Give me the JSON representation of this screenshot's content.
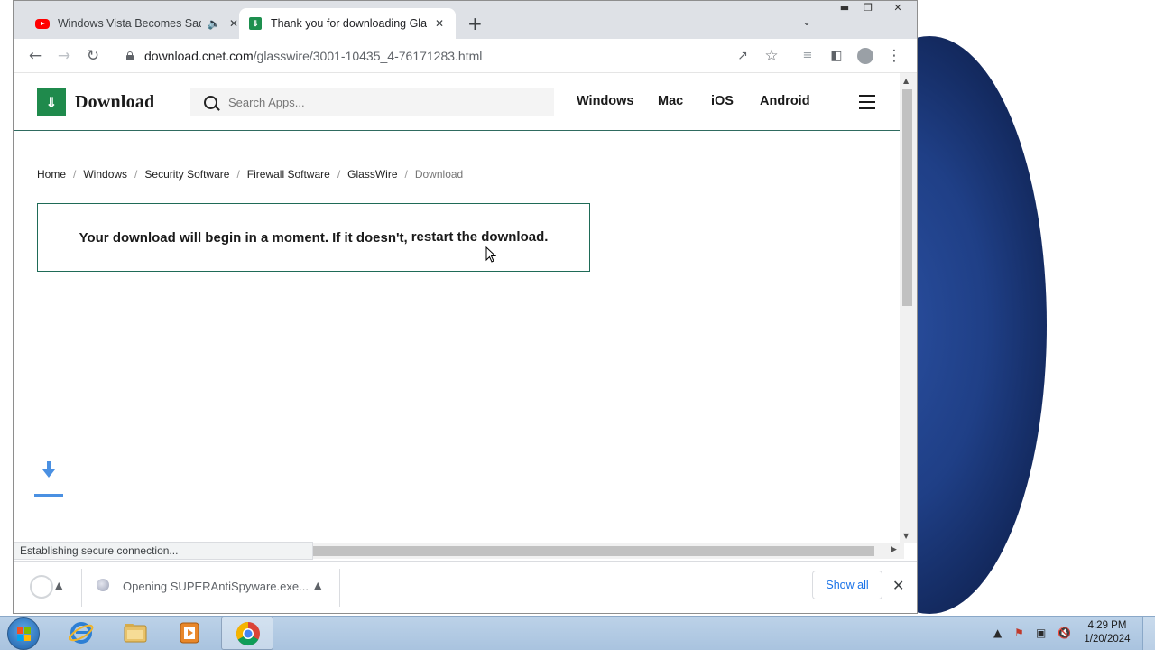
{
  "browser": {
    "tabs": [
      {
        "title": "Windows Vista Becomes Sad",
        "favicon": "youtube-icon",
        "muted_icon": "speaker-icon"
      },
      {
        "title": "Thank you for downloading Glass",
        "favicon": "cnet-download-icon",
        "active": true
      }
    ],
    "url_domain": "download.cnet.com",
    "url_path": "/glasswire/3001-10435_4-76171283.html",
    "status_text": "Establishing secure connection..."
  },
  "site": {
    "logo_text": "Download",
    "search_placeholder": "Search Apps...",
    "nav": [
      "Windows",
      "Mac",
      "iOS",
      "Android"
    ],
    "breadcrumb": [
      "Home",
      "Windows",
      "Security Software",
      "Firewall Software",
      "GlassWire",
      "Download"
    ],
    "notice_text": "Your download will begin in a moment. If it doesn't,",
    "notice_link": "restart the download."
  },
  "download_shelf": {
    "file_label": "Opening SUPERAntiSpyware.exe...",
    "show_all": "Show all"
  },
  "taskbar": {
    "clock_time": "4:29 PM",
    "clock_date": "1/20/2024",
    "apps": [
      "internet-explorer-icon",
      "file-explorer-icon",
      "media-player-icon",
      "chrome-icon"
    ]
  },
  "colors": {
    "brand_green": "#1f8a4c",
    "notice_border": "#1f6b57",
    "link_blue": "#1a73e8",
    "download_arrow": "#4a90e2"
  }
}
